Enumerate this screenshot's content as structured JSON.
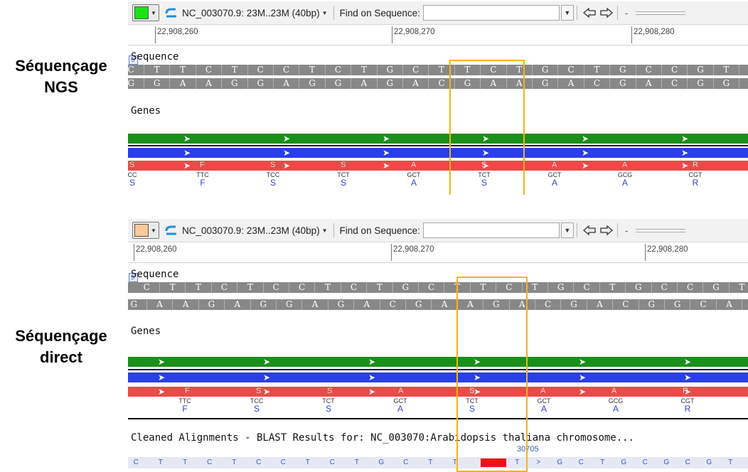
{
  "labels": {
    "ngs_line1": "Séquençage",
    "ngs_line2": "NGS",
    "direct_line1": "Séquençage",
    "direct_line2": "direct"
  },
  "colors": {
    "ngs_swatch": "#19e419",
    "direct_swatch": "#fbc99b",
    "highlight": "#f4b41a",
    "cds_green": "#1a8f1a",
    "cds_blue": "#2b3fe6",
    "cds_red": "#f04848"
  },
  "panels": [
    {
      "toolbar": {
        "color_button_icon": "color-swatch",
        "undo_icon": "undo-icon",
        "region_label": "NC_003070.9: 23M..23M (40bp)",
        "find_label": "Find on Sequence:",
        "find_value": "",
        "zoom_minus": "-"
      },
      "ruler": [
        "22,908,260",
        "22,908,270",
        "22,908,280"
      ],
      "sequence_label": "Sequence",
      "forward": "CTTCTCCTCTGCTTCTGCTGCCGTT",
      "reverse": "GGAAGGAGGAGACGAAGACGACGGCAA",
      "genes_label": "Genes",
      "red_marks": [
        "S",
        "F",
        "S",
        "S",
        "A",
        "S",
        "A",
        "A",
        "R"
      ],
      "codons": [
        {
          "codon": "CC",
          "aa": "S"
        },
        {
          "codon": "TTC",
          "aa": "F"
        },
        {
          "codon": "TCC",
          "aa": "S"
        },
        {
          "codon": "TCT",
          "aa": "S"
        },
        {
          "codon": "GCT",
          "aa": "A"
        },
        {
          "codon": "TCT",
          "aa": "S"
        },
        {
          "codon": "GCT",
          "aa": "A"
        },
        {
          "codon": "GCG",
          "aa": "A"
        },
        {
          "codon": "CGT",
          "aa": "R"
        }
      ]
    },
    {
      "toolbar": {
        "color_button_icon": "color-swatch",
        "undo_icon": "undo-icon",
        "region_label": "NC_003070.9: 23M..23M (40bp)",
        "find_label": "Find on Sequence:",
        "find_value": "",
        "zoom_minus": "-"
      },
      "ruler": [
        "22,908,260",
        "22,908,270",
        "22,908,280"
      ],
      "sequence_label": "Sequence",
      "forward": "CTTCTCCTCTGCTTCTGCTGCCGT",
      "reverse": "GAAGAGGAGACGAAGACGACGGCA",
      "genes_label": "Genes",
      "red_marks": [
        "F",
        "S",
        "S",
        "A",
        "S",
        "A",
        "A",
        "R"
      ],
      "codons": [
        {
          "codon": "TTC",
          "aa": "F"
        },
        {
          "codon": "TCC",
          "aa": "S"
        },
        {
          "codon": "TCT",
          "aa": "S"
        },
        {
          "codon": "GCT",
          "aa": "A"
        },
        {
          "codon": "TCT",
          "aa": "S"
        },
        {
          "codon": "GCT",
          "aa": "A"
        },
        {
          "codon": "GCG",
          "aa": "A"
        },
        {
          "codon": "CGT",
          "aa": "R"
        }
      ],
      "blast_title": "Cleaned Alignments - BLAST Results for: NC_003070:Arabidopsis thaliana chromosome...",
      "blast_coord": "30705",
      "blast_row_left": "C T T C T C C T C T G C T T",
      "blast_row_right": "T > G C T G C G C G T"
    }
  ]
}
